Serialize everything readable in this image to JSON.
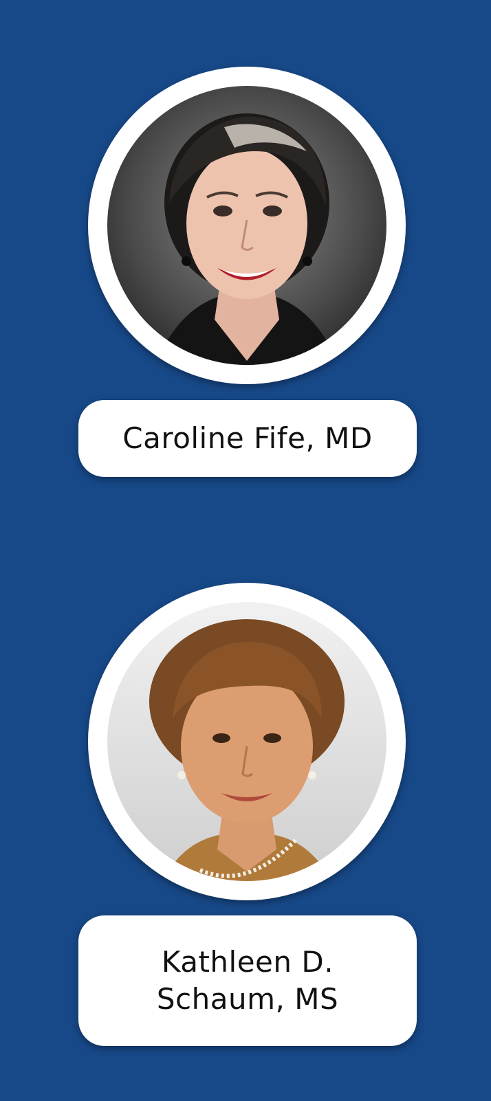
{
  "colors": {
    "background": "#174887",
    "card": "#ffffff",
    "text": "#111111"
  },
  "profiles": [
    {
      "name": "Caroline Fife, MD",
      "photo": "headshot-photo"
    },
    {
      "name_lines": [
        "Kathleen D.",
        "Schaum, MS"
      ],
      "photo": "headshot-photo"
    }
  ]
}
